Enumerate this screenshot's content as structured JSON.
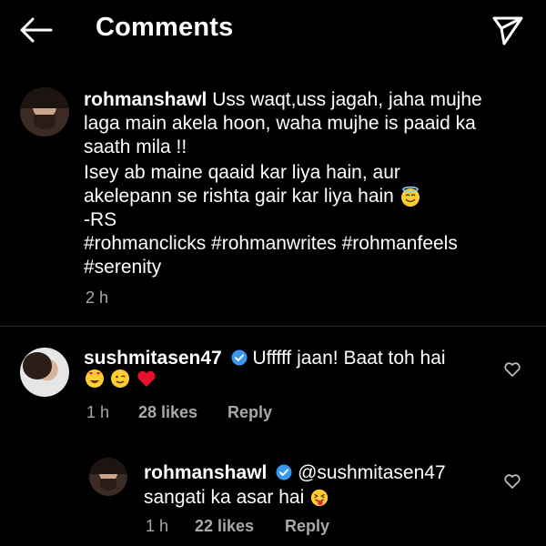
{
  "header": {
    "title": "Comments"
  },
  "caption": {
    "username": "rohmanshawl",
    "line1": "Uss waqt,uss jagah, jaha mujhe",
    "line2": "laga main akela hoon, waha mujhe is paaid ka",
    "line3": "saath mila !!",
    "line4": "Isey ab maine qaaid kar liya hain, aur",
    "line5": "akelepann se rishta gair kar liya hain",
    "line6": "-RS",
    "line7": "#rohmanclicks #rohmanwrites #rohmanfeels",
    "line8": "#serenity",
    "time": "2 h"
  },
  "comment1": {
    "username": "sushmitasen47",
    "text": "Ufffff jaan! Baat toh hai",
    "time": "1 h",
    "likes": "28 likes",
    "reply_label": "Reply"
  },
  "reply1": {
    "username": "rohmanshawl",
    "mention": "@sushmitasen47",
    "text": "sangati ka asar hai",
    "time": "1 h",
    "likes": "22 likes",
    "reply_label": "Reply"
  },
  "colors": {
    "background": "#000000",
    "text": "#ffffff",
    "meta": "#a8a8a8",
    "verified": "#3897f0"
  },
  "icons": [
    "back-arrow-icon",
    "send-icon",
    "verified-icon",
    "heart-icon",
    "smiling-halo-emoji",
    "heart-eyes-emoji",
    "wink-emoji",
    "red-heart-emoji",
    "tongue-wink-emoji"
  ]
}
